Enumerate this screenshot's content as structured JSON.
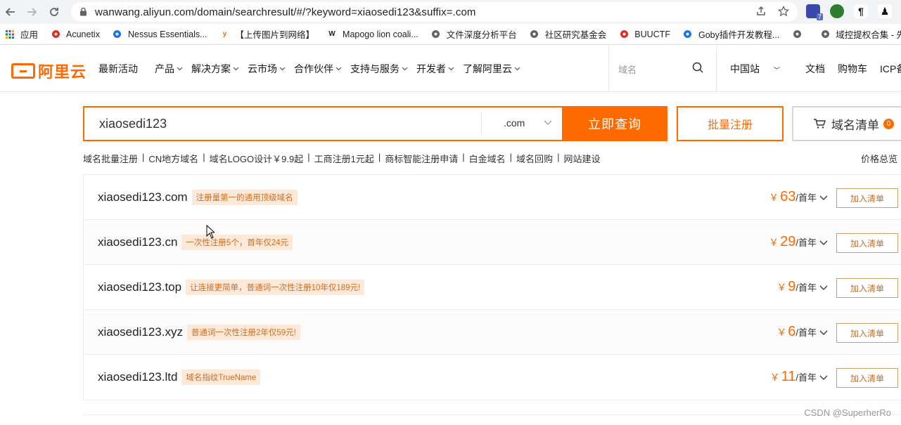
{
  "browser": {
    "url": "wanwang.aliyun.com/domain/searchresult/#/?keyword=xiaosedi123&suffix=.com",
    "ext_badge": "7",
    "bookmarks": [
      {
        "label": "应用",
        "icon": "apps-grid-icon",
        "color": "#5f6368"
      },
      {
        "label": "Acunetix",
        "icon": "acunetix-icon",
        "color": "#d93025"
      },
      {
        "label": "Nessus Essentials...",
        "icon": "nessus-icon",
        "color": "#1a73e8"
      },
      {
        "label": "【上传图片到网络】",
        "icon": "y-icon",
        "color": "#e8710a"
      },
      {
        "label": "Mapogo lion coali...",
        "icon": "wikipedia-icon",
        "color": "#202124"
      },
      {
        "label": "文件深度分析平台",
        "icon": "file-analysis-icon",
        "color": "#5f6368"
      },
      {
        "label": "社区研究基金会",
        "icon": "globe-icon",
        "color": "#5f6368"
      },
      {
        "label": "BUUCTF",
        "icon": "buuctf-icon",
        "color": "#d93025"
      },
      {
        "label": "Goby插件开发教程...",
        "icon": "goby-icon",
        "color": "#1a73e8"
      },
      {
        "label": "",
        "icon": "globe-icon",
        "color": "#5f6368"
      },
      {
        "label": "域控提权合集 - 先...",
        "icon": "globe-icon",
        "color": "#5f6368"
      }
    ]
  },
  "header": {
    "logo_text": "阿里云",
    "nav": [
      {
        "label": "最新活动",
        "caret": false
      },
      {
        "label": "产品",
        "caret": true
      },
      {
        "label": "解决方案",
        "caret": true
      },
      {
        "label": "云市场",
        "caret": true
      },
      {
        "label": "合作伙伴",
        "caret": true
      },
      {
        "label": "支持与服务",
        "caret": true
      },
      {
        "label": "开发者",
        "caret": true
      },
      {
        "label": "了解阿里云",
        "caret": true
      }
    ],
    "search_placeholder": "域名",
    "right": {
      "site": "中国站",
      "docs": "文档",
      "cart": "购物车",
      "icp": "ICP备案"
    }
  },
  "search": {
    "keyword": "xiaosedi123",
    "suffix": ".com",
    "query_label": "立即查询",
    "batch_label": "批量注册",
    "list_label": "域名清单",
    "list_count": "0"
  },
  "quick_links": [
    "域名批量注册",
    "CN地方域名",
    "域名LOGO设计￥9.9起",
    "工商注册1元起",
    "商标智能注册申请",
    "白金域名",
    "域名回购",
    "网站建设"
  ],
  "price_link": "价格总览",
  "results": [
    {
      "domain": "xiaosedi123.com",
      "promo": "注册量第一的通用顶级域名",
      "price": "63",
      "unit": "/首年",
      "action": "加入清单"
    },
    {
      "domain": "xiaosedi123.cn",
      "promo": "一次性注册5个，首年仅24元",
      "price": "29",
      "unit": "/首年",
      "action": "加入清单"
    },
    {
      "domain": "xiaosedi123.top",
      "promo": "让连接更简单，普通词一次性注册10年仅189元!",
      "price": "9",
      "unit": "/首年",
      "action": "加入清单"
    },
    {
      "domain": "xiaosedi123.xyz",
      "promo": "普通词一次性注册2年仅59元!",
      "price": "6",
      "unit": "/首年",
      "action": "加入清单"
    },
    {
      "domain": "xiaosedi123.ltd",
      "promo": "域名指纹TrueName",
      "price": "11",
      "unit": "/首年",
      "action": "加入清单"
    }
  ],
  "currency": "￥",
  "watermark": "CSDN @SuperherRo",
  "colors": {
    "accent": "#ff6a00",
    "promo_bg": "#fde9d9",
    "promo_text": "#ce6c1b"
  }
}
